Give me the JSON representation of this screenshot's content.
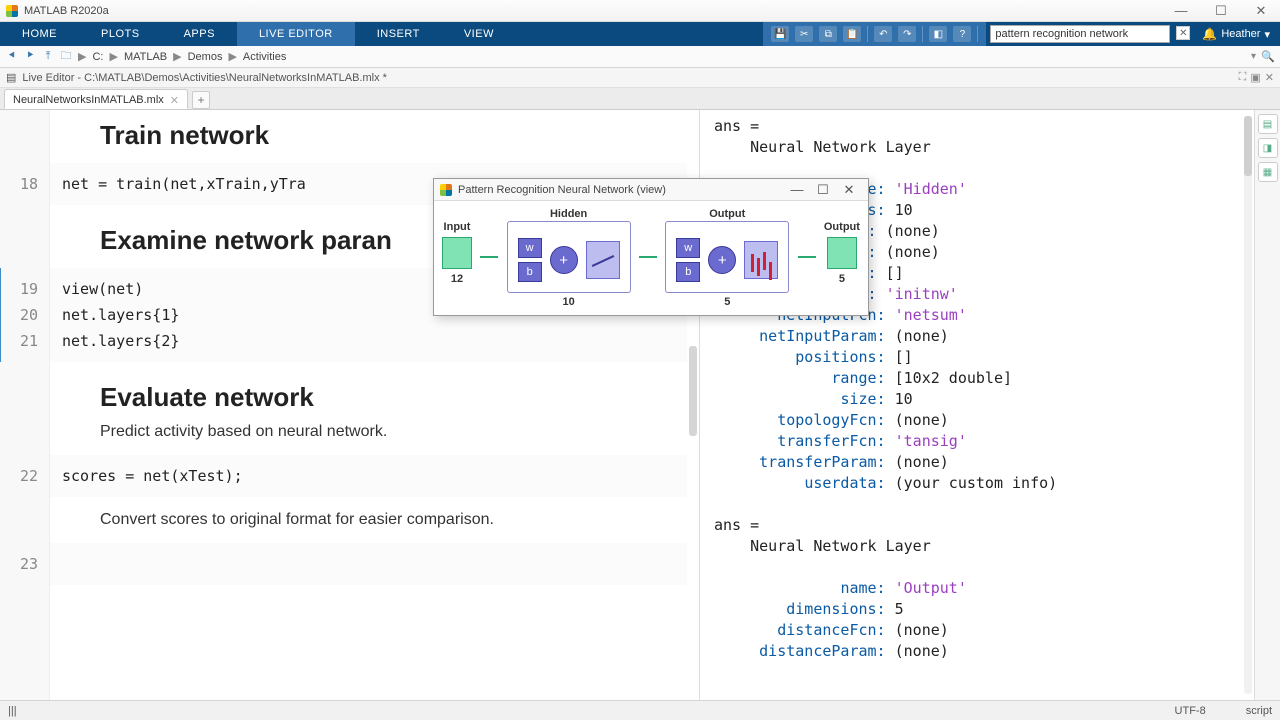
{
  "window": {
    "title": "MATLAB R2020a",
    "min": "—",
    "max": "☐",
    "close": "✕"
  },
  "tabs": {
    "home": "HOME",
    "plots": "PLOTS",
    "apps": "APPS",
    "liveeditor": "LIVE EDITOR",
    "insert": "INSERT",
    "view": "VIEW"
  },
  "search": {
    "placeholder": "pattern recognition network"
  },
  "user": {
    "name": "Heather",
    "caret": "▾",
    "bell": "🔔"
  },
  "breadcrumbs": {
    "items": [
      "C:",
      "MATLAB",
      "Demos",
      "Activities"
    ],
    "sep": "▶"
  },
  "livepath": {
    "label": "Live Editor - C:\\MATLAB\\Demos\\Activities\\NeuralNetworksInMATLAB.mlx *"
  },
  "doctab": {
    "name": "NeuralNetworksInMATLAB.mlx",
    "dirty": "✕",
    "plus": "+"
  },
  "sections": {
    "train_title": "Train network",
    "exam_title": "Examine network paran",
    "eval_title": "Evaluate network",
    "eval_desc": "Predict activity based on neural network.",
    "convert_desc": "Convert scores to original format for easier comparison."
  },
  "code": {
    "l18_no": "18",
    "l18": "net = train(net,xTrain,yTra",
    "l19_no": "19",
    "l19": "view(net)",
    "l20_no": "20",
    "l20": "net.layers{1}",
    "l21_no": "21",
    "l21": "net.layers{2}",
    "l22_no": "22",
    "l22": "scores = net(xTest);",
    "l23_no": "23"
  },
  "netwin": {
    "title": "Pattern Recognition Neural Network (view)",
    "min": "—",
    "max": "☐",
    "close": "✕",
    "input_label": "Input",
    "input_size": "12",
    "hidden_label": "Hidden",
    "hidden_size": "10",
    "output_label": "Output",
    "output_size": "5",
    "out_label": "Output",
    "out_size": "5",
    "w": "w",
    "b": "b",
    "plus": "+"
  },
  "out": {
    "ans1": "ans =",
    "hdr1": "    Neural Network Layer",
    "p_name": "name:",
    "v_name": "'Hidden'",
    "p_dim": "dimensions:",
    "v_dim": "10",
    "p_dfcn_t": "distanceFcn:",
    "v_none": "(none)",
    "p_dparam_t": "distanceParam:",
    "p_dist": "distances:",
    "v_empty": "[]",
    "p_ifcn": "initFcn:",
    "v_ifcn": "'initnw'",
    "p_nifcn": "netInputFcn:",
    "v_nifcn": "'netsum'",
    "p_niprm": "netInputParam:",
    "p_pos": "positions:",
    "p_range": "range:",
    "v_range": "[10x2 double]",
    "p_size": "size:",
    "v_size": "10",
    "p_tfcn": "topologyFcn:",
    "p_xfcn": "transferFcn:",
    "v_xfcn": "'tansig'",
    "p_xprm": "transferParam:",
    "p_ud": "userdata:",
    "v_ud": "(your custom info)",
    "ans2": "ans =",
    "hdr2": "    Neural Network Layer",
    "v2_name": "'Output'",
    "v2_dim": "5",
    "trail_name": "name:",
    "trail_dfcn": "distanceFcn:",
    "trail_dparam": "distanceParam:",
    "trunc_fcn": "Fcn:",
    "trunc_ram": "ram:",
    "trunc_nces": "nces:",
    "trunc_tFcn": "tFcn:",
    "trunc_ions": "ions:"
  },
  "status": {
    "encoding": "UTF-8",
    "type": "script"
  }
}
